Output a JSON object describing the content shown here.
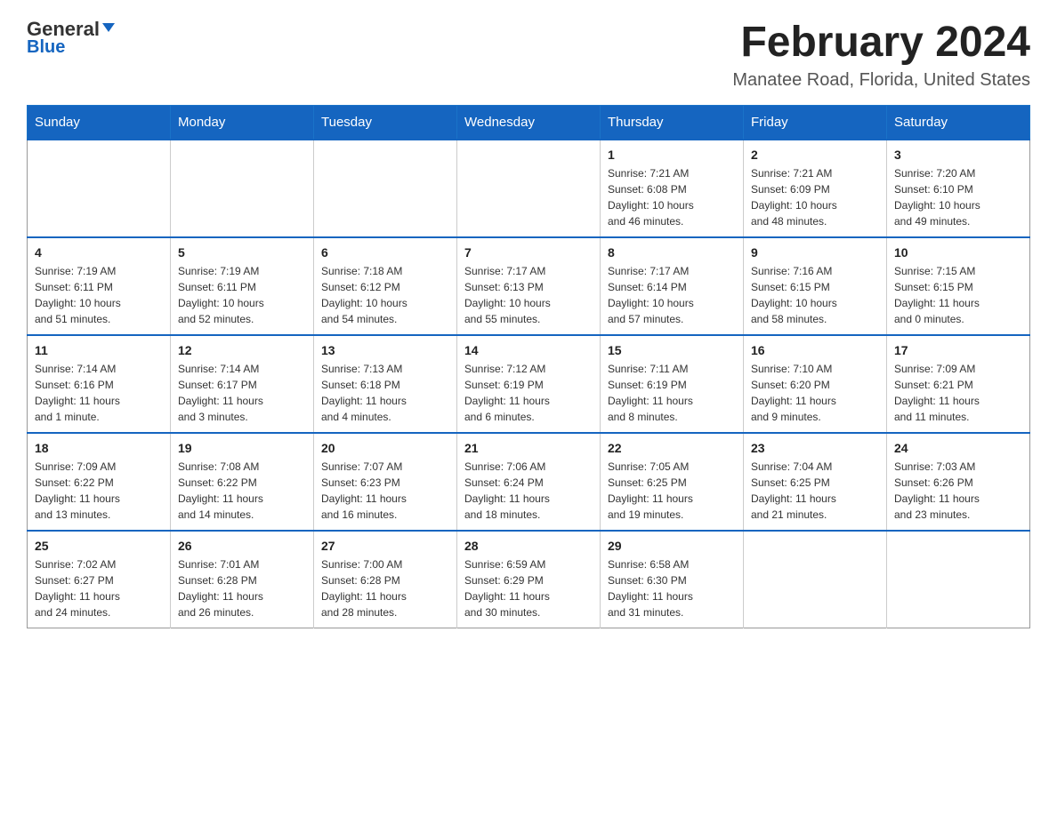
{
  "logo": {
    "general": "General",
    "arrow": "",
    "blue_label": "Blue"
  },
  "title": "February 2024",
  "subtitle": "Manatee Road, Florida, United States",
  "days_of_week": [
    "Sunday",
    "Monday",
    "Tuesday",
    "Wednesday",
    "Thursday",
    "Friday",
    "Saturday"
  ],
  "weeks": [
    [
      {
        "day": "",
        "info": ""
      },
      {
        "day": "",
        "info": ""
      },
      {
        "day": "",
        "info": ""
      },
      {
        "day": "",
        "info": ""
      },
      {
        "day": "1",
        "info": "Sunrise: 7:21 AM\nSunset: 6:08 PM\nDaylight: 10 hours\nand 46 minutes."
      },
      {
        "day": "2",
        "info": "Sunrise: 7:21 AM\nSunset: 6:09 PM\nDaylight: 10 hours\nand 48 minutes."
      },
      {
        "day": "3",
        "info": "Sunrise: 7:20 AM\nSunset: 6:10 PM\nDaylight: 10 hours\nand 49 minutes."
      }
    ],
    [
      {
        "day": "4",
        "info": "Sunrise: 7:19 AM\nSunset: 6:11 PM\nDaylight: 10 hours\nand 51 minutes."
      },
      {
        "day": "5",
        "info": "Sunrise: 7:19 AM\nSunset: 6:11 PM\nDaylight: 10 hours\nand 52 minutes."
      },
      {
        "day": "6",
        "info": "Sunrise: 7:18 AM\nSunset: 6:12 PM\nDaylight: 10 hours\nand 54 minutes."
      },
      {
        "day": "7",
        "info": "Sunrise: 7:17 AM\nSunset: 6:13 PM\nDaylight: 10 hours\nand 55 minutes."
      },
      {
        "day": "8",
        "info": "Sunrise: 7:17 AM\nSunset: 6:14 PM\nDaylight: 10 hours\nand 57 minutes."
      },
      {
        "day": "9",
        "info": "Sunrise: 7:16 AM\nSunset: 6:15 PM\nDaylight: 10 hours\nand 58 minutes."
      },
      {
        "day": "10",
        "info": "Sunrise: 7:15 AM\nSunset: 6:15 PM\nDaylight: 11 hours\nand 0 minutes."
      }
    ],
    [
      {
        "day": "11",
        "info": "Sunrise: 7:14 AM\nSunset: 6:16 PM\nDaylight: 11 hours\nand 1 minute."
      },
      {
        "day": "12",
        "info": "Sunrise: 7:14 AM\nSunset: 6:17 PM\nDaylight: 11 hours\nand 3 minutes."
      },
      {
        "day": "13",
        "info": "Sunrise: 7:13 AM\nSunset: 6:18 PM\nDaylight: 11 hours\nand 4 minutes."
      },
      {
        "day": "14",
        "info": "Sunrise: 7:12 AM\nSunset: 6:19 PM\nDaylight: 11 hours\nand 6 minutes."
      },
      {
        "day": "15",
        "info": "Sunrise: 7:11 AM\nSunset: 6:19 PM\nDaylight: 11 hours\nand 8 minutes."
      },
      {
        "day": "16",
        "info": "Sunrise: 7:10 AM\nSunset: 6:20 PM\nDaylight: 11 hours\nand 9 minutes."
      },
      {
        "day": "17",
        "info": "Sunrise: 7:09 AM\nSunset: 6:21 PM\nDaylight: 11 hours\nand 11 minutes."
      }
    ],
    [
      {
        "day": "18",
        "info": "Sunrise: 7:09 AM\nSunset: 6:22 PM\nDaylight: 11 hours\nand 13 minutes."
      },
      {
        "day": "19",
        "info": "Sunrise: 7:08 AM\nSunset: 6:22 PM\nDaylight: 11 hours\nand 14 minutes."
      },
      {
        "day": "20",
        "info": "Sunrise: 7:07 AM\nSunset: 6:23 PM\nDaylight: 11 hours\nand 16 minutes."
      },
      {
        "day": "21",
        "info": "Sunrise: 7:06 AM\nSunset: 6:24 PM\nDaylight: 11 hours\nand 18 minutes."
      },
      {
        "day": "22",
        "info": "Sunrise: 7:05 AM\nSunset: 6:25 PM\nDaylight: 11 hours\nand 19 minutes."
      },
      {
        "day": "23",
        "info": "Sunrise: 7:04 AM\nSunset: 6:25 PM\nDaylight: 11 hours\nand 21 minutes."
      },
      {
        "day": "24",
        "info": "Sunrise: 7:03 AM\nSunset: 6:26 PM\nDaylight: 11 hours\nand 23 minutes."
      }
    ],
    [
      {
        "day": "25",
        "info": "Sunrise: 7:02 AM\nSunset: 6:27 PM\nDaylight: 11 hours\nand 24 minutes."
      },
      {
        "day": "26",
        "info": "Sunrise: 7:01 AM\nSunset: 6:28 PM\nDaylight: 11 hours\nand 26 minutes."
      },
      {
        "day": "27",
        "info": "Sunrise: 7:00 AM\nSunset: 6:28 PM\nDaylight: 11 hours\nand 28 minutes."
      },
      {
        "day": "28",
        "info": "Sunrise: 6:59 AM\nSunset: 6:29 PM\nDaylight: 11 hours\nand 30 minutes."
      },
      {
        "day": "29",
        "info": "Sunrise: 6:58 AM\nSunset: 6:30 PM\nDaylight: 11 hours\nand 31 minutes."
      },
      {
        "day": "",
        "info": ""
      },
      {
        "day": "",
        "info": ""
      }
    ]
  ]
}
